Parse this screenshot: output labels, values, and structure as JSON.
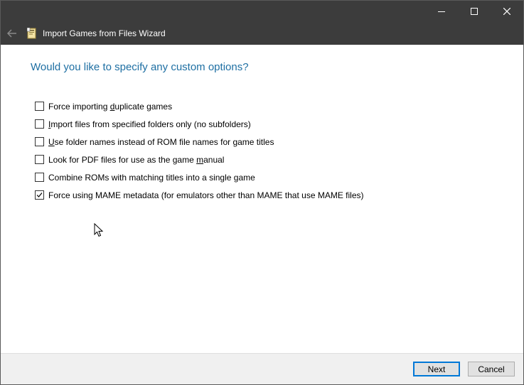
{
  "window": {
    "title": "Import Games from Files Wizard",
    "controls": {
      "minimize": "minimize-icon",
      "maximize": "maximize-icon",
      "close": "close-icon"
    },
    "back": "back-arrow-icon"
  },
  "page": {
    "heading": "Would you like to specify any custom options?",
    "options": [
      {
        "pre": "Force importing ",
        "key": "d",
        "post": "uplicate games",
        "checked": false
      },
      {
        "pre": "",
        "key": "I",
        "post": "mport files from specified folders only (no subfolders)",
        "checked": false
      },
      {
        "pre": "",
        "key": "U",
        "post": "se folder names instead of ROM file names for game titles",
        "checked": false
      },
      {
        "pre": "Look for PDF files for use as the game ",
        "key": "m",
        "post": "anual",
        "checked": false
      },
      {
        "pre": "Combine ROMs with matching titles into a single game",
        "key": "",
        "post": "",
        "checked": false
      },
      {
        "pre": "Force using MAME metadata (for emulators other than MAME that use MAME files)",
        "key": "",
        "post": "",
        "checked": true
      }
    ]
  },
  "footer": {
    "next_label": "Next",
    "cancel_label": "Cancel"
  },
  "colors": {
    "accent": "#0078d7",
    "heading": "#1e6fa3",
    "titlebar": "#3c3c3c"
  }
}
